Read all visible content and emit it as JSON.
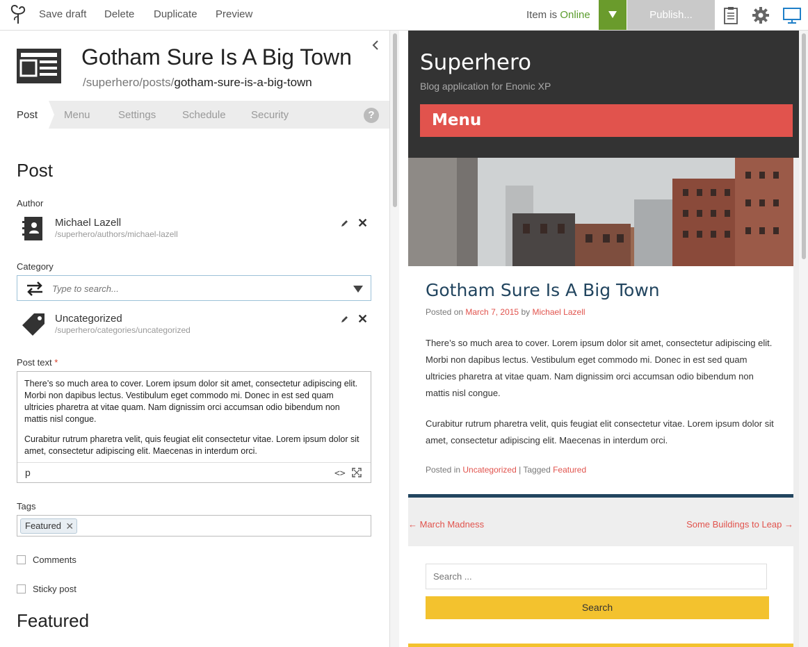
{
  "toolbar": {
    "save_draft": "Save draft",
    "delete": "Delete",
    "duplicate": "Duplicate",
    "preview": "Preview",
    "status_prefix": "Item is",
    "status_value": "Online",
    "publish": "Publish...",
    "colors": {
      "online": "#5a9c2c",
      "dropdown": "#6a9b2c",
      "publish_disabled": "#c9c9c9",
      "desktop_icon": "#1f7fc8"
    }
  },
  "content": {
    "title": "Gotham Sure Is A Big Town",
    "path_prefix": "/superhero/posts/",
    "path_name": "gotham-sure-is-a-big-town"
  },
  "tabs": [
    {
      "label": "Post"
    },
    {
      "label": "Menu"
    },
    {
      "label": "Settings"
    },
    {
      "label": "Schedule"
    },
    {
      "label": "Security"
    }
  ],
  "form": {
    "section_title": "Post",
    "author_label": "Author",
    "author_name": "Michael Lazell",
    "author_path": "/superhero/authors/michael-lazell",
    "category_label": "Category",
    "category_placeholder": "Type to search...",
    "category_name": "Uncategorized",
    "category_path": "/superhero/categories/uncategorized",
    "post_text_label": "Post text",
    "required_mark": "*",
    "post_paragraph_1": "There’s so much area to cover. Lorem ipsum dolor sit amet, consectetur adipiscing elit. Morbi non dapibus lectus. Vestibulum eget commodo mi. Donec in est sed quam ultricies pharetra at vitae quam. Nam dignissim orci accumsan odio bibendum non mattis nisl congue.",
    "post_paragraph_2": "Curabitur rutrum pharetra velit, quis feugiat elit consectetur vitae. Lorem ipsum dolor sit amet, consectetur adipiscing elit. Maecenas in interdum orci.",
    "editor_path": "p",
    "editor_code": "<>",
    "tags_label": "Tags",
    "tag_value": "Featured",
    "tag_remove": "✕",
    "comments_label": "Comments",
    "sticky_label": "Sticky post",
    "featured_title": "Featured",
    "help": "?"
  },
  "preview": {
    "site_title": "Superhero",
    "site_description": "Blog application for Enonic XP",
    "menu_label": "Menu",
    "article_title": "Gotham Sure Is A Big Town",
    "posted_on": "Posted on",
    "date": "March 7, 2015",
    "by": "by",
    "author": "Michael Lazell",
    "paragraph_1": "There’s so much area to cover. Lorem ipsum dolor sit amet, consectetur adipiscing elit. Morbi non dapibus lectus. Vestibulum eget commodo mi. Donec in est sed quam ultricies pharetra at vitae quam. Nam dignissim orci accumsan odio bibendum non mattis nisl congue.",
    "paragraph_2": "Curabitur rutrum pharetra velit, quis feugiat elit consectetur vitae. Lorem ipsum dolor sit amet, consectetur adipiscing elit. Maecenas in interdum orci.",
    "posted_in": "Posted in",
    "category": "Uncategorized",
    "separator": "|",
    "tagged": "Tagged",
    "tag": "Featured",
    "prev_link": "← March Madness",
    "next_link": "Some Buildings to Leap →",
    "search_placeholder": "Search ...",
    "search_button": "Search",
    "colors": {
      "header": "#333333",
      "menu": "#e1534d",
      "title": "#22455f",
      "accent": "#f3c22e"
    }
  }
}
